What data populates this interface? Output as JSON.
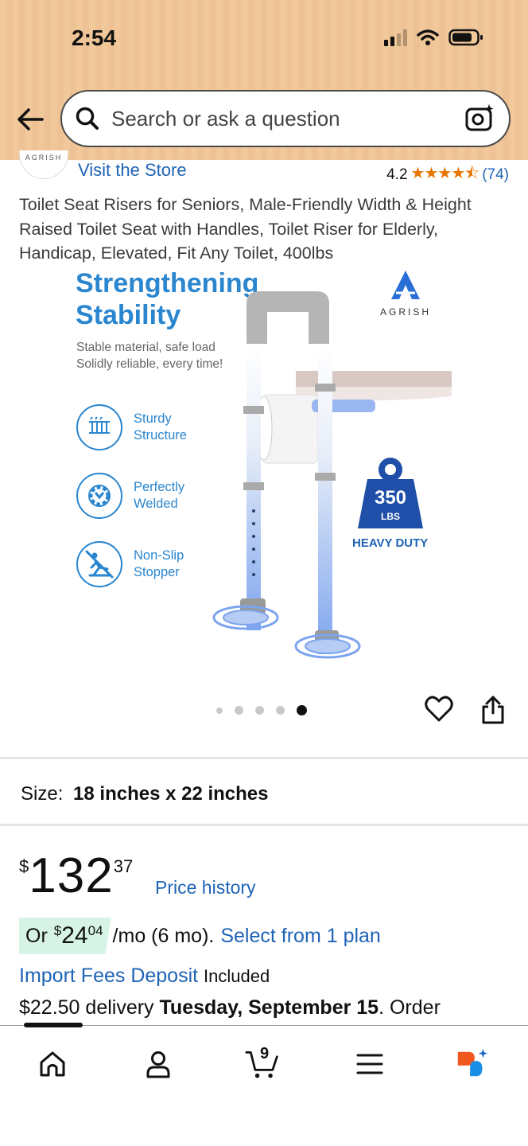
{
  "status_bar": {
    "time": "2:54"
  },
  "search": {
    "placeholder": "Search or ask a question"
  },
  "store": {
    "logo_text": "AGRISH",
    "visit_label": "Visit the Store",
    "rating": "4.2",
    "stars": "★★★★⯪",
    "review_count": "(74)"
  },
  "product": {
    "title": "Toilet Seat Risers for Seniors, Male-Friendly Width & Height Raised Toilet Seat with Handles, Toilet Riser for Elderly, Handicap, Elevated, Fit Any Toilet, 400lbs",
    "image": {
      "headline_1": "Strengthening",
      "headline_2": "Stability",
      "sub_1": "Stable material, safe load",
      "sub_2": "Solidly reliable, every time!",
      "features": [
        {
          "line1": "Sturdy",
          "line2": "Structure",
          "icon": "spring-icon"
        },
        {
          "line1": "Perfectly",
          "line2": "Welded",
          "icon": "gear-icon"
        },
        {
          "line1": "Non-Slip",
          "line2": "Stopper",
          "icon": "slip-icon"
        }
      ],
      "brand": "AGRISH",
      "weight": "350",
      "weight_unit": "LBS",
      "heavy_duty": "HEAVY DUTY"
    },
    "carousel": {
      "count": 5,
      "active_index": 4
    }
  },
  "size": {
    "label": "Size:",
    "value": "18 inches x 22 inches"
  },
  "price": {
    "currency": "$",
    "whole": "132",
    "fraction": "37",
    "history_link": "Price history"
  },
  "monthly": {
    "prefix": "Or",
    "currency": "$",
    "whole": "24",
    "fraction": "04",
    "term": "/mo (6 mo).",
    "plan_link": "Select from 1 plan"
  },
  "fees": {
    "link": "Import Fees Deposit",
    "status": "Included"
  },
  "delivery": {
    "amount": "$22.50 delivery",
    "date": "Tuesday, September 15",
    "suffix": ". Order"
  },
  "nav": {
    "items": [
      "home-icon",
      "account-icon",
      "cart-icon",
      "menu-icon",
      "rufus-icon"
    ],
    "cart_count": "9"
  },
  "colors": {
    "header": "#f0c89a",
    "link": "#1f63b5",
    "accent_blue": "#2a86cf",
    "star": "#e77600",
    "installment_bg": "#d6f3e6"
  }
}
